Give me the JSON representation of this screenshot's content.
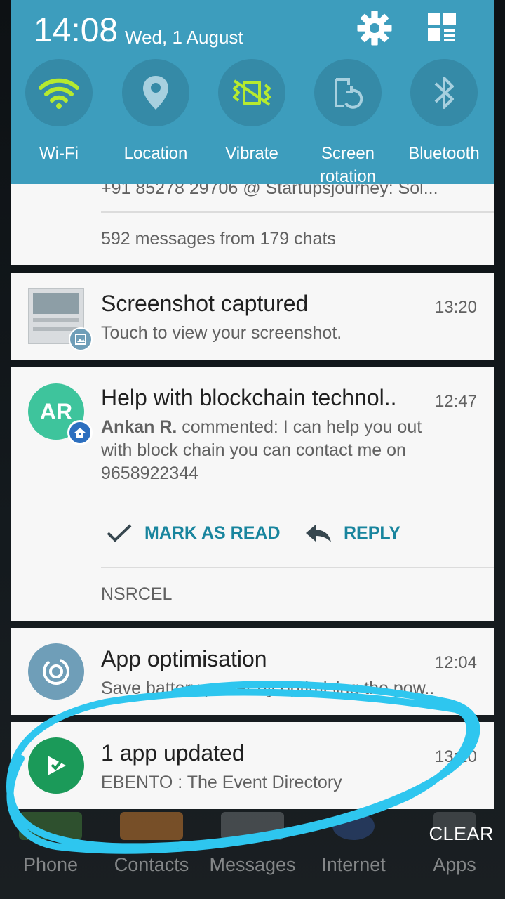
{
  "status": {
    "time": "14:08",
    "date": "Wed, 1 August"
  },
  "quick_settings": [
    {
      "label": "Wi-Fi",
      "icon": "wifi-icon",
      "active": true
    },
    {
      "label": "Location",
      "icon": "location-pin-icon",
      "active": false
    },
    {
      "label": "Vibrate",
      "icon": "vibrate-icon",
      "active": true
    },
    {
      "label": "Screen rotation",
      "icon": "screen-rotation-icon",
      "active": false
    },
    {
      "label": "Bluetooth",
      "icon": "bluetooth-icon",
      "active": false
    }
  ],
  "notifications": {
    "whatsapp": {
      "partial_line": "+91 85278 29706 @ Startupsjourney: Sol...",
      "summary": "592 messages from 179 chats"
    },
    "screenshot": {
      "title": "Screenshot captured",
      "time": "13:20",
      "text": "Touch to view your screenshot."
    },
    "comment": {
      "avatar_initials": "AR",
      "title": "Help with blockchain technol..",
      "time": "12:47",
      "author": "Ankan R.",
      "body": " commented: I can help you out",
      "body2": "with block chain you can contact me on",
      "body3": "9658922344",
      "action_mark": "MARK AS READ",
      "action_reply": "REPLY",
      "source": "NSRCEL"
    },
    "optimisation": {
      "title": "App optimisation",
      "time": "12:04",
      "text": "Save battery power by optimising the pow.."
    },
    "update": {
      "title": "1 app updated",
      "time": "13:20",
      "text": "EBENTO : The Event Directory"
    }
  },
  "dock": [
    {
      "label": "Phone"
    },
    {
      "label": "Contacts"
    },
    {
      "label": "Messages"
    },
    {
      "label": "Internet"
    },
    {
      "label": "Apps"
    }
  ],
  "clear_label": "CLEAR",
  "colors": {
    "header": "#3d9dbd",
    "tile": "#358aa7",
    "active_icon": "#b6ea2f",
    "accent": "#19859e",
    "highlight_circle": "#2ec6ef"
  }
}
